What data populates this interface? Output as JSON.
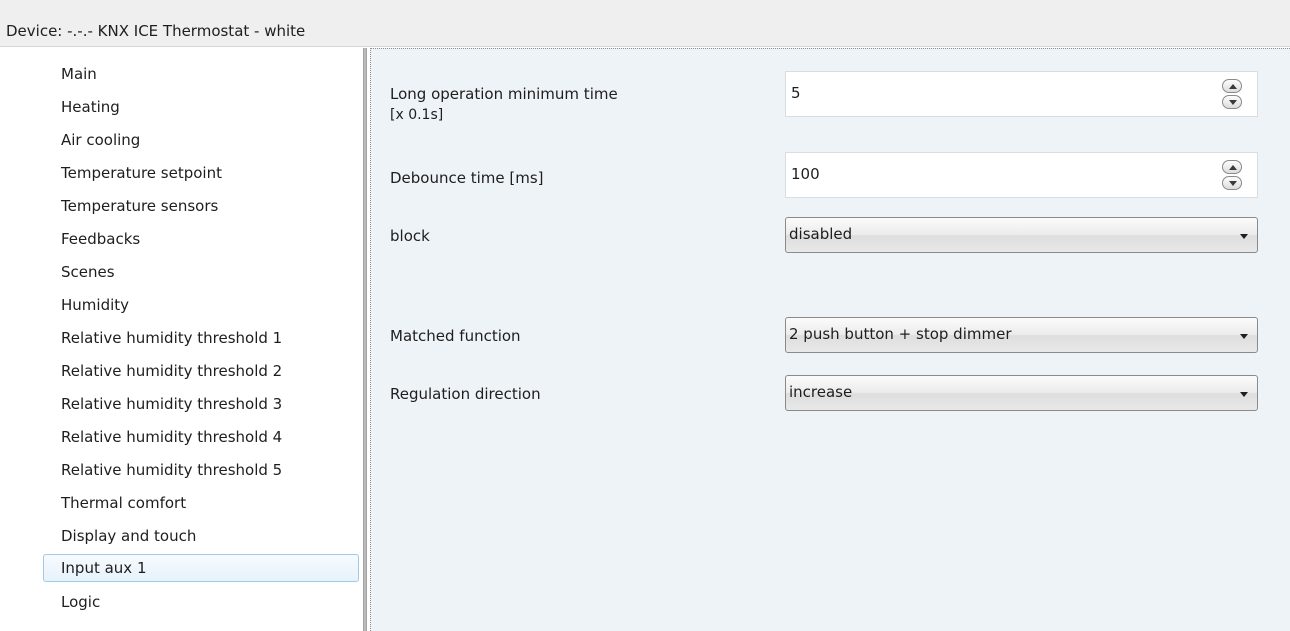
{
  "window": {
    "title": "Device: -.-.-  KNX ICE Thermostat - white"
  },
  "sidebar": {
    "items": [
      {
        "label": "Main"
      },
      {
        "label": "Heating"
      },
      {
        "label": "Air cooling"
      },
      {
        "label": "Temperature setpoint"
      },
      {
        "label": "Temperature sensors"
      },
      {
        "label": "Feedbacks"
      },
      {
        "label": "Scenes"
      },
      {
        "label": "Humidity"
      },
      {
        "label": "Relative humidity threshold 1"
      },
      {
        "label": "Relative humidity threshold 2"
      },
      {
        "label": "Relative humidity threshold 3"
      },
      {
        "label": "Relative humidity threshold 4"
      },
      {
        "label": "Relative humidity threshold 5"
      },
      {
        "label": "Thermal comfort"
      },
      {
        "label": "Display and touch"
      },
      {
        "label": "Input aux 1"
      },
      {
        "label": "Logic"
      }
    ],
    "selected_label": "Input aux 1"
  },
  "params": {
    "long_operation": {
      "label_line1": "Long operation minimum time",
      "label_line2": "[x 0.1s]",
      "value": "5"
    },
    "debounce": {
      "label": "Debounce time [ms]",
      "value": "100"
    },
    "block": {
      "label": "block",
      "value": "disabled"
    },
    "matched_function": {
      "label": "Matched function",
      "value": "2 push button + stop dimmer"
    },
    "regulation_direction": {
      "label": "Regulation direction",
      "value": "increase"
    }
  },
  "colors": {
    "content_background": "#eef3f8",
    "selection_border": "#9fcae8"
  }
}
